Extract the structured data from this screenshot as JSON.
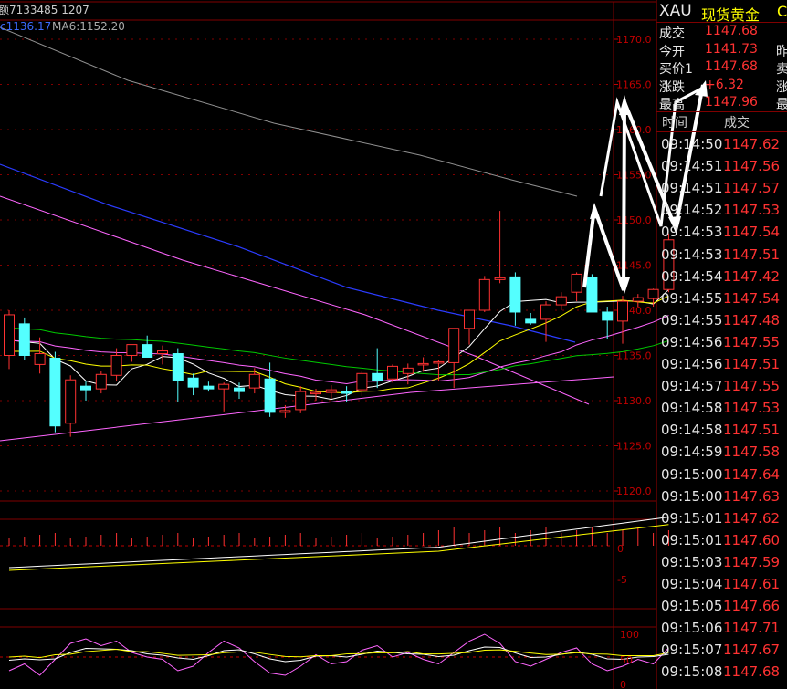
{
  "header": {
    "volume_label": "额7133485 1207",
    "ma_label_partial": "c1136.17",
    "ma6_label": "MA6:1152.20"
  },
  "price_axis": [
    "1170.0",
    "1165.0",
    "1160.0",
    "1155.0",
    "1150.0",
    "1145.0",
    "1140.0",
    "1135.0",
    "1130.0",
    "1125.0",
    "1120.0"
  ],
  "vol_axis": [
    "0",
    "-5"
  ],
  "osc_axis": [
    "100",
    "50",
    "0"
  ],
  "symbol": {
    "code": "XAU",
    "name": "现货黄金",
    "extra": "C"
  },
  "quote": [
    {
      "label": "成交",
      "value": "1147.68",
      "label2": ""
    },
    {
      "label": "今开",
      "value": "1141.73",
      "label2": "昨"
    },
    {
      "label": "买价1",
      "value": "1147.68",
      "label2": "卖"
    },
    {
      "label": "涨跌",
      "value": "+6.32",
      "label2": "涨"
    },
    {
      "label": "最高",
      "value": "1147.96",
      "label2": "最"
    }
  ],
  "tick_header": {
    "time": "时间",
    "price": "成交"
  },
  "ticks": [
    {
      "time": "09:14:50",
      "price": "1147.62"
    },
    {
      "time": "09:14:51",
      "price": "1147.56"
    },
    {
      "time": "09:14:51",
      "price": "1147.57"
    },
    {
      "time": "09:14:52",
      "price": "1147.53"
    },
    {
      "time": "09:14:53",
      "price": "1147.54"
    },
    {
      "time": "09:14:53",
      "price": "1147.51"
    },
    {
      "time": "09:14:54",
      "price": "1147.42"
    },
    {
      "time": "09:14:55",
      "price": "1147.54"
    },
    {
      "time": "09:14:55",
      "price": "1147.48"
    },
    {
      "time": "09:14:56",
      "price": "1147.55"
    },
    {
      "time": "09:14:56",
      "price": "1147.51"
    },
    {
      "time": "09:14:57",
      "price": "1147.55"
    },
    {
      "time": "09:14:58",
      "price": "1147.53"
    },
    {
      "time": "09:14:58",
      "price": "1147.51"
    },
    {
      "time": "09:14:59",
      "price": "1147.58"
    },
    {
      "time": "09:15:00",
      "price": "1147.64"
    },
    {
      "time": "09:15:00",
      "price": "1147.63"
    },
    {
      "time": "09:15:01",
      "price": "1147.62"
    },
    {
      "time": "09:15:01",
      "price": "1147.60"
    },
    {
      "time": "09:15:03",
      "price": "1147.59"
    },
    {
      "time": "09:15:04",
      "price": "1147.61"
    },
    {
      "time": "09:15:05",
      "price": "1147.66"
    },
    {
      "time": "09:15:06",
      "price": "1147.71"
    },
    {
      "time": "09:15:07",
      "price": "1147.67"
    },
    {
      "time": "09:15:08",
      "price": "1147.68"
    }
  ],
  "candles": [
    {
      "o": 1135.0,
      "h": 1140.0,
      "l": 1133.5,
      "c": 1139.5
    },
    {
      "o": 1138.5,
      "h": 1139.2,
      "l": 1134.5,
      "c": 1135.0
    },
    {
      "o": 1134.0,
      "h": 1137.0,
      "l": 1133.0,
      "c": 1135.2
    },
    {
      "o": 1134.7,
      "h": 1135.4,
      "l": 1126.5,
      "c": 1127.2
    },
    {
      "o": 1127.5,
      "h": 1132.8,
      "l": 1126.0,
      "c": 1132.3
    },
    {
      "o": 1131.6,
      "h": 1132.2,
      "l": 1130.0,
      "c": 1131.2
    },
    {
      "o": 1131.3,
      "h": 1133.3,
      "l": 1130.8,
      "c": 1132.9
    },
    {
      "o": 1132.8,
      "h": 1135.8,
      "l": 1132.2,
      "c": 1135.0
    },
    {
      "o": 1135.0,
      "h": 1136.2,
      "l": 1134.3,
      "c": 1136.2
    },
    {
      "o": 1136.2,
      "h": 1137.2,
      "l": 1135.4,
      "c": 1134.8
    },
    {
      "o": 1135.2,
      "h": 1136.1,
      "l": 1134.0,
      "c": 1135.5
    },
    {
      "o": 1135.2,
      "h": 1135.8,
      "l": 1129.8,
      "c": 1132.2
    },
    {
      "o": 1132.5,
      "h": 1133.0,
      "l": 1130.6,
      "c": 1131.5
    },
    {
      "o": 1131.6,
      "h": 1132.1,
      "l": 1131.0,
      "c": 1131.3
    },
    {
      "o": 1131.3,
      "h": 1132.0,
      "l": 1128.8,
      "c": 1131.8
    },
    {
      "o": 1131.4,
      "h": 1132.0,
      "l": 1130.2,
      "c": 1131.0
    },
    {
      "o": 1131.4,
      "h": 1133.6,
      "l": 1130.8,
      "c": 1132.9
    },
    {
      "o": 1132.4,
      "h": 1134.2,
      "l": 1128.2,
      "c": 1128.7
    },
    {
      "o": 1128.7,
      "h": 1129.5,
      "l": 1128.1,
      "c": 1128.9
    },
    {
      "o": 1129.0,
      "h": 1131.6,
      "l": 1128.6,
      "c": 1131.0
    },
    {
      "o": 1130.9,
      "h": 1131.3,
      "l": 1130.0,
      "c": 1130.9
    },
    {
      "o": 1130.9,
      "h": 1131.7,
      "l": 1130.2,
      "c": 1131.2
    },
    {
      "o": 1131.0,
      "h": 1131.6,
      "l": 1129.8,
      "c": 1130.8
    },
    {
      "o": 1131.2,
      "h": 1133.3,
      "l": 1130.5,
      "c": 1133.0
    },
    {
      "o": 1133.0,
      "h": 1135.8,
      "l": 1131.4,
      "c": 1132.2
    },
    {
      "o": 1132.4,
      "h": 1134.0,
      "l": 1132.0,
      "c": 1133.8
    },
    {
      "o": 1133.0,
      "h": 1134.1,
      "l": 1131.8,
      "c": 1133.6
    },
    {
      "o": 1134.1,
      "h": 1134.8,
      "l": 1133.2,
      "c": 1134.1
    },
    {
      "o": 1134.3,
      "h": 1134.5,
      "l": 1132.2,
      "c": 1134.3
    },
    {
      "o": 1134.2,
      "h": 1136.3,
      "l": 1131.4,
      "c": 1138.0
    },
    {
      "o": 1138.0,
      "h": 1139.8,
      "l": 1136.2,
      "c": 1140.0
    },
    {
      "o": 1140.0,
      "h": 1143.8,
      "l": 1139.8,
      "c": 1143.4
    },
    {
      "o": 1143.4,
      "h": 1151.0,
      "l": 1143.0,
      "c": 1143.6
    },
    {
      "o": 1143.7,
      "h": 1144.2,
      "l": 1138.3,
      "c": 1139.8
    },
    {
      "o": 1139.0,
      "h": 1139.7,
      "l": 1138.4,
      "c": 1138.6
    },
    {
      "o": 1139.0,
      "h": 1141.0,
      "l": 1136.5,
      "c": 1140.6
    },
    {
      "o": 1140.6,
      "h": 1142.0,
      "l": 1140.0,
      "c": 1141.5
    },
    {
      "o": 1142.0,
      "h": 1144.2,
      "l": 1141.0,
      "c": 1144.0
    },
    {
      "o": 1143.6,
      "h": 1144.0,
      "l": 1139.8,
      "c": 1139.8
    },
    {
      "o": 1139.8,
      "h": 1140.4,
      "l": 1136.8,
      "c": 1138.9
    },
    {
      "o": 1138.8,
      "h": 1141.6,
      "l": 1136.3,
      "c": 1141.0
    },
    {
      "o": 1141.0,
      "h": 1141.8,
      "l": 1140.4,
      "c": 1141.4
    },
    {
      "o": 1141.3,
      "h": 1142.4,
      "l": 1140.4,
      "c": 1142.3
    },
    {
      "o": 1142.3,
      "h": 1148.5,
      "l": 1142.0,
      "c": 1147.8
    }
  ],
  "colors": {
    "up": "#ff3232",
    "down": "#54ffff",
    "grid": "#800000",
    "axis_text": "#c00000",
    "ma_white": "#ffffff",
    "ma_yellow": "#ffff00",
    "ma_magenta": "#ff66ff",
    "ma_green": "#00c800",
    "ma_blue": "#2b3cff",
    "ma_gray": "#909090",
    "label_blue": "#3c6bff",
    "label_gray": "#aaaaaa"
  }
}
